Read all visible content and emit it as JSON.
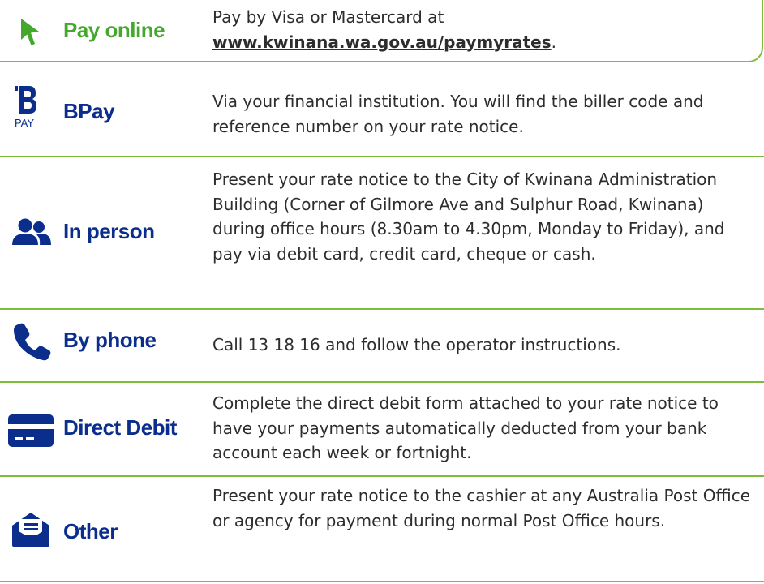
{
  "colors": {
    "accent_green": "#7cbd3a",
    "label_blue": "#0b2d8c",
    "online_green": "#43a82b",
    "text": "#2d2d2d"
  },
  "rows": [
    {
      "icon": "cursor-arrow-icon",
      "label": "Pay online",
      "desc_line1": "Pay by Visa or Mastercard at",
      "link": "www.kwinana.wa.gov.au/paymyrates",
      "link_suffix": "."
    },
    {
      "icon": "bpay-logo-icon",
      "label": "BPay",
      "desc": "Via your financial institution. You will find the biller code and reference number on your rate notice."
    },
    {
      "icon": "people-icon",
      "label": "In person",
      "desc": "Present your rate notice to the City of Kwinana Administration Building (Corner of Gilmore Ave and Sulphur Road, Kwinana) during office hours (8.30am to 4.30pm, Monday to Friday), and pay via debit card, credit card, cheque or cash."
    },
    {
      "icon": "phone-icon",
      "label": "By phone",
      "desc": "Call 13 18 16 and follow the operator instructions."
    },
    {
      "icon": "credit-card-icon",
      "label": "Direct Debit",
      "desc": "Complete the direct debit form attached to your rate notice to have your payments automatically deducted from your bank account each week or fortnight."
    },
    {
      "icon": "envelope-icon",
      "label": "Other",
      "desc": "Present your rate notice to the cashier at any Australia Post Office or agency for payment during normal Post Office hours."
    }
  ],
  "bpay_logo_text": "PAY"
}
